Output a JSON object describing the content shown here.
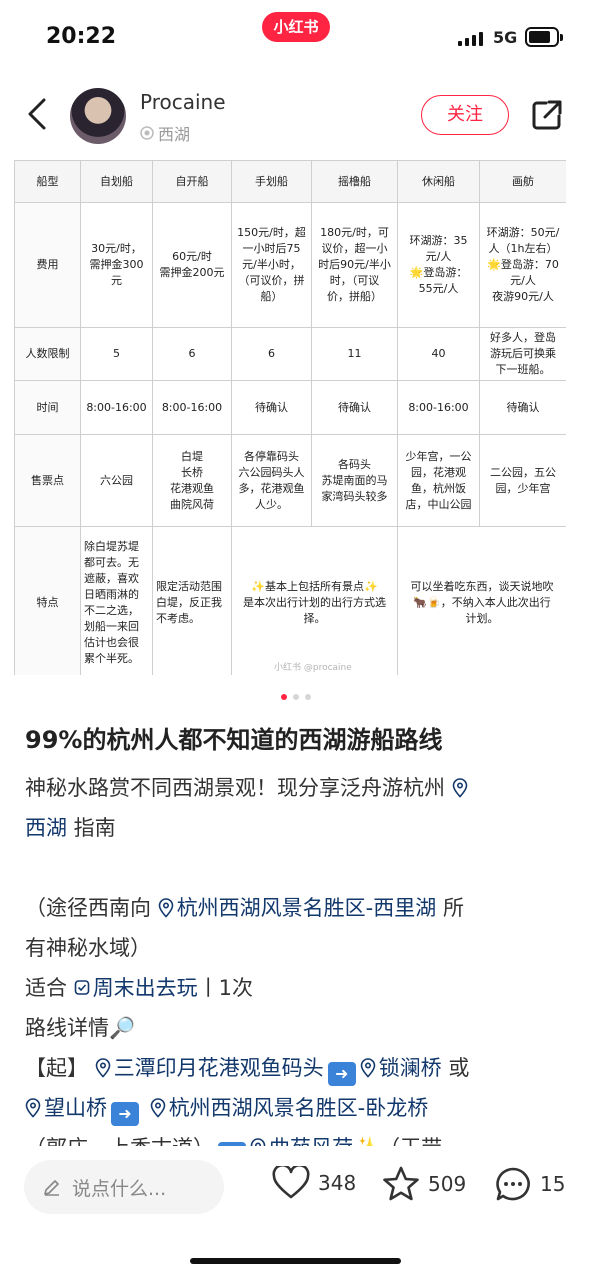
{
  "status": {
    "time": "20:22",
    "brand": "小红书",
    "network": "5G",
    "battery_fraction": 0.8
  },
  "header": {
    "username": "Procaine",
    "location": "西湖",
    "follow_label": "关注"
  },
  "table": {
    "headers": [
      "船型",
      "自划船",
      "自开船",
      "手划船",
      "摇橹船",
      "休闲船",
      "画舫"
    ],
    "rows": [
      {
        "label": "费用",
        "cells": [
          "30元/时，\n需押金300\n元",
          "60元/时\n需押金200元",
          "150元/时，超\n一小时后75\n元/半小时，\n（可议价，拼\n船）",
          "180元/时，可\n议价，超一小\n时后90元/半小\n时，（可议\n价，拼船）",
          "环湖游：35\n元/人\n🌟登岛游：\n55元/人",
          "环湖游：50元/\n人（1h左右）\n🌟登岛游：70\n元/人\n夜游90元/人"
        ]
      },
      {
        "label": "人数限制",
        "cells": [
          "5",
          "6",
          "6",
          "11",
          "40",
          "好多人，登岛\n游玩后可换乘\n下一班船。"
        ]
      },
      {
        "label": "时间",
        "cells": [
          "8:00-16:00",
          "8:00-16:00",
          "待确认",
          "待确认",
          "8:00-16:00",
          "待确认"
        ]
      },
      {
        "label": "售票点",
        "cells": [
          "六公园",
          "白堤\n长桥\n花港观鱼\n曲院风荷",
          "各停靠码头\n六公园码头人\n多，花港观鱼\n人少。",
          "各码头\n苏堤南面的马\n家湾码头较多",
          "少年宫，一公\n园，花港观\n鱼，杭州饭\n店，中山公园",
          "二公园，五公\n园，少年宫"
        ]
      },
      {
        "label": "特点",
        "cells": [
          "除白堤苏堤\n都可去。无\n遮蔽，喜欢\n日晒雨淋的\n不二之选，\n划船一来回\n估计也会很\n累个半死。",
          "限定活动范围\n白堤，反正我\n不考虑。",
          "✨基本上包括所有景点✨\n是本次出行计划的出行方式选\n择。",
          "可以坐着吃东西，谈天说地吹\n🐂🍺，不纳入本人此次出行\n计划。"
        ]
      }
    ],
    "watermark": "小红书 @procaine"
  },
  "post": {
    "title": "99%的杭州人都不知道的西湖游船路线",
    "lines": {
      "l1": "神秘水路赏不同西湖景观！现分享泛舟游杭州",
      "l2_tag": "西湖",
      "l2_rest": " 指南",
      "l3_pre": "（途径西南向 ",
      "l3_tag": "杭州西湖风景名胜区-西里湖",
      "l3_post": " 所",
      "l4": "有神秘水域）",
      "l5_pre": "适合 ",
      "l5_tag": "周末出去玩",
      "l5_post": "丨1次",
      "l6": "路线详情🔎",
      "l7_pre": "【起】 ",
      "l7_tag1": "三潭印月花港观鱼码头",
      "l7_tag2": "锁澜桥",
      "l7_post": " 或",
      "l8_tag1": "望山桥",
      "l8_tag2": "杭州西湖风景名胜区-卧龙桥",
      "l9_pre": "（郭庄、上香古道）",
      "l9_tag": "曲苑风荷",
      "l9_post": "✨（玉带"
    }
  },
  "bottom": {
    "comment_placeholder": "说点什么...",
    "likes": "348",
    "stars": "509",
    "comments": "15"
  }
}
